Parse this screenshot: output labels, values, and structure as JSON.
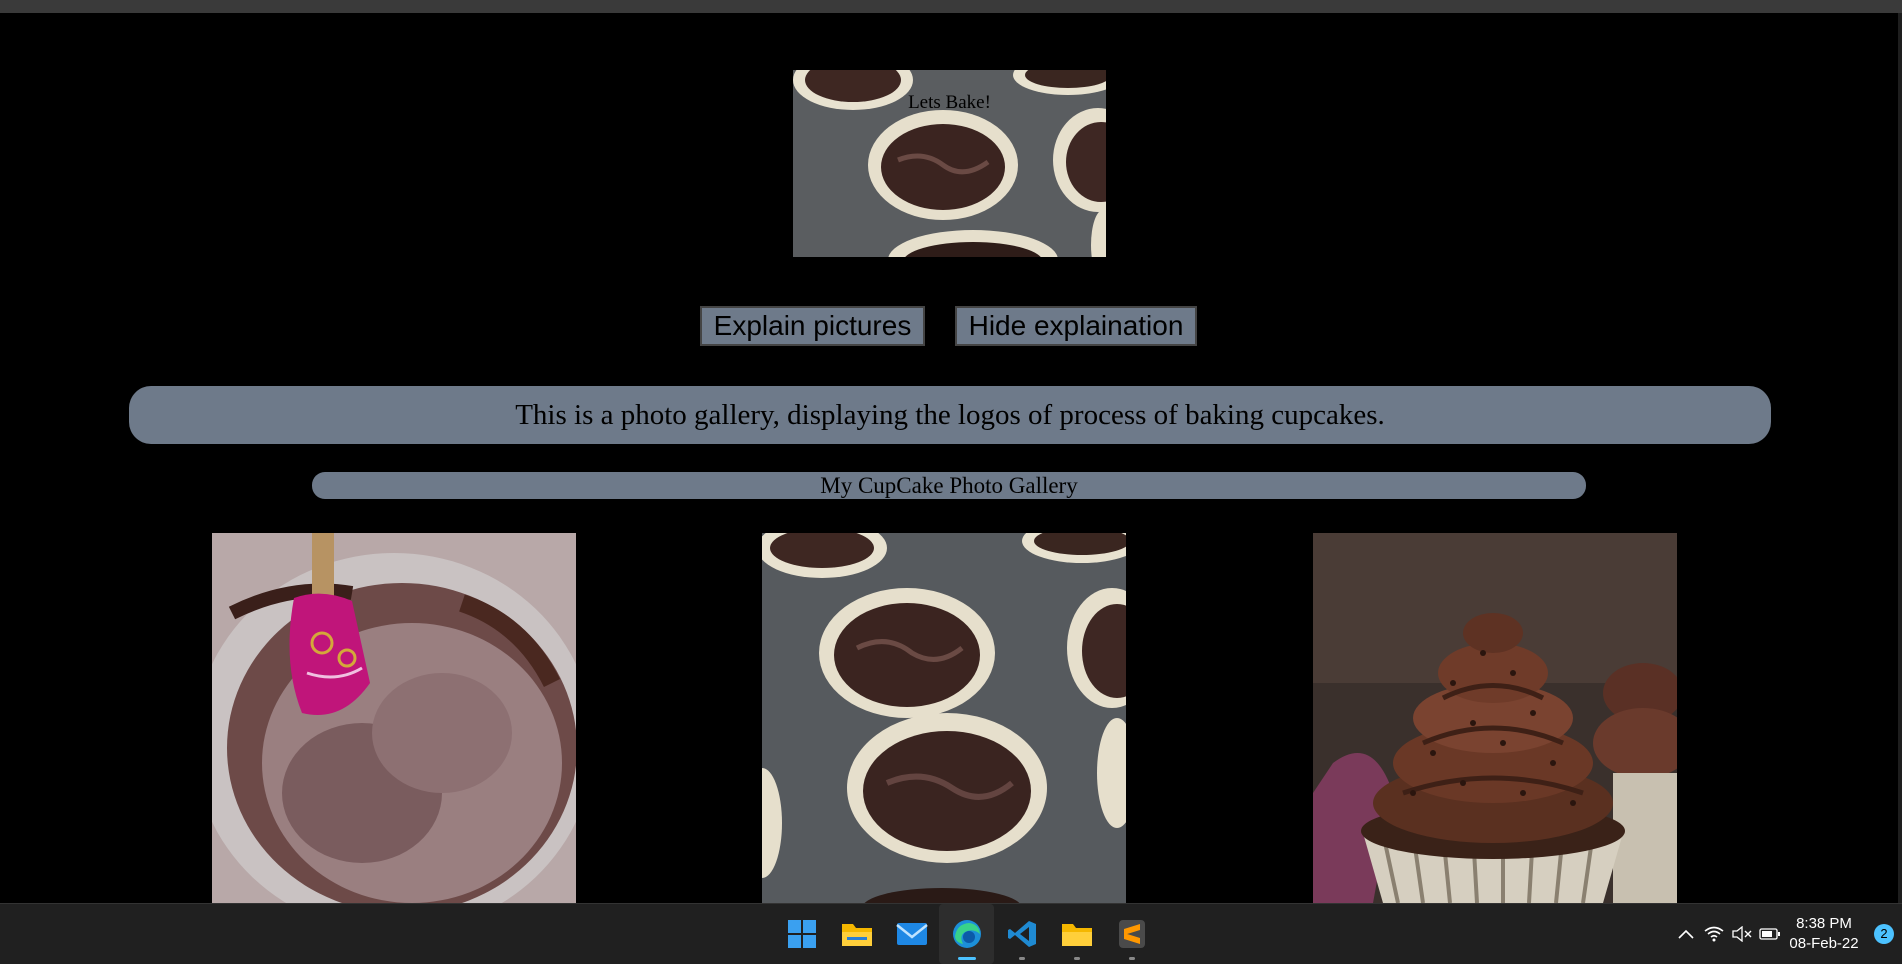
{
  "hero": {
    "title": "Lets Bake!"
  },
  "buttons": {
    "explain": "Explain pictures",
    "hide": "Hide explaination"
  },
  "explanation": "This is a photo gallery, displaying the logos of process of baking cupcakes.",
  "gallery": {
    "title": "My CupCake Photo Gallery",
    "photos": [
      "chocolate-batter-bowl",
      "cupcake-tin-batter",
      "frosted-chocolate-cupcake"
    ]
  },
  "taskbar": {
    "apps": [
      "windows-start",
      "file-explorer",
      "mail",
      "edge",
      "vscode",
      "folder",
      "sublime-text"
    ],
    "clock": {
      "time": "8:38 PM",
      "date": "08-Feb-22"
    },
    "notifications": "2"
  },
  "colors": {
    "panel": "#6e7a8a",
    "accent": "#4cc2ff",
    "background": "#000000"
  }
}
